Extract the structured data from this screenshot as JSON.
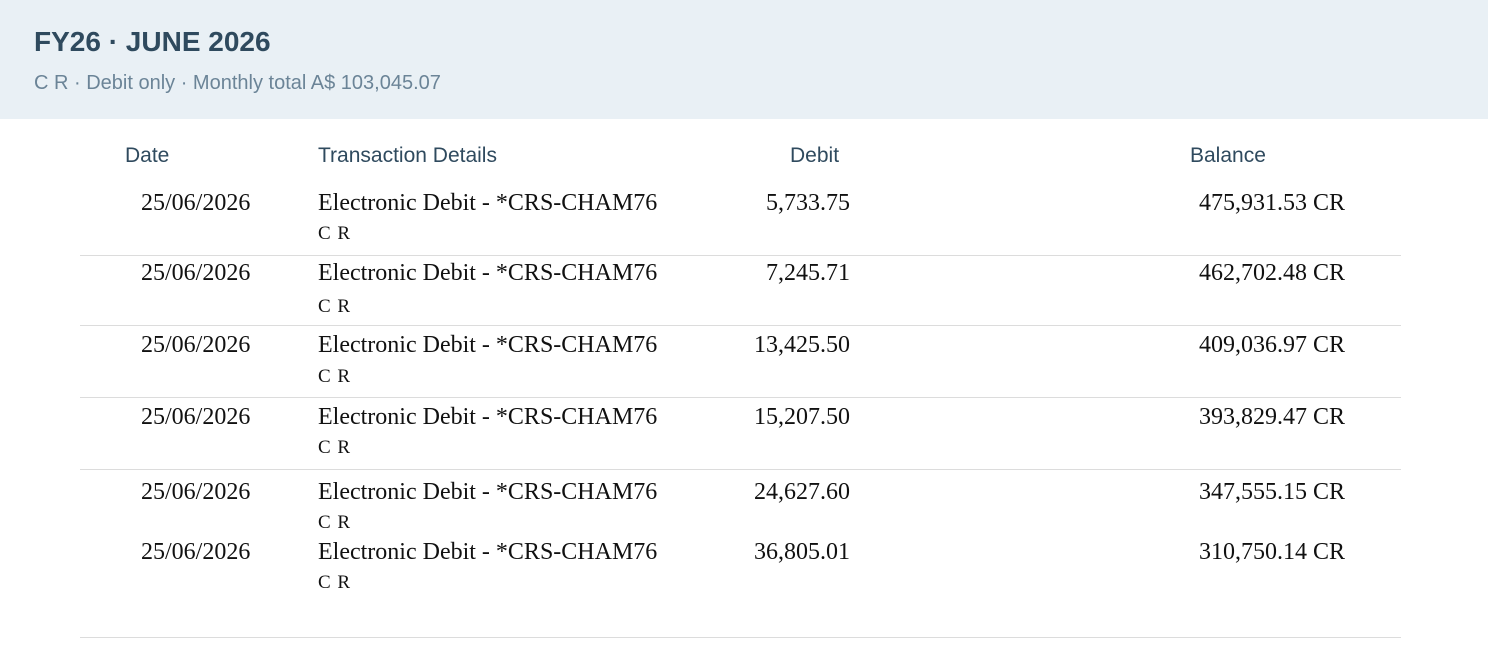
{
  "header": {
    "title": "FY26 · JUNE 2026",
    "subtitle": "C R · Debit only · Monthly total A$ 103,045.07"
  },
  "columns": {
    "date": "Date",
    "details": "Transaction Details",
    "debit": "Debit",
    "balance": "Balance"
  },
  "rows": [
    {
      "date": "25/06/2026",
      "description": "Electronic Debit - *CRS-CHAM76",
      "sub": "C R",
      "debit": "5,733.75",
      "balance": "475,931.53 CR"
    },
    {
      "date": "25/06/2026",
      "description": "Electronic Debit - *CRS-CHAM76",
      "sub": "C R",
      "debit": "7,245.71",
      "balance": "462,702.48 CR"
    },
    {
      "date": "25/06/2026",
      "description": "Electronic Debit - *CRS-CHAM76",
      "sub": "C R",
      "debit": "13,425.50",
      "balance": "409,036.97 CR"
    },
    {
      "date": "25/06/2026",
      "description": "Electronic Debit - *CRS-CHAM76",
      "sub": "C R",
      "debit": "15,207.50",
      "balance": "393,829.47 CR"
    },
    {
      "date": "25/06/2026",
      "description": "Electronic Debit - *CRS-CHAM76",
      "sub": "C R",
      "debit": "24,627.60",
      "balance": "347,555.15 CR"
    },
    {
      "date": "25/06/2026",
      "description": "Electronic Debit - *CRS-CHAM76",
      "sub": "C R",
      "debit": "36,805.01",
      "balance": "310,750.14 CR"
    }
  ]
}
